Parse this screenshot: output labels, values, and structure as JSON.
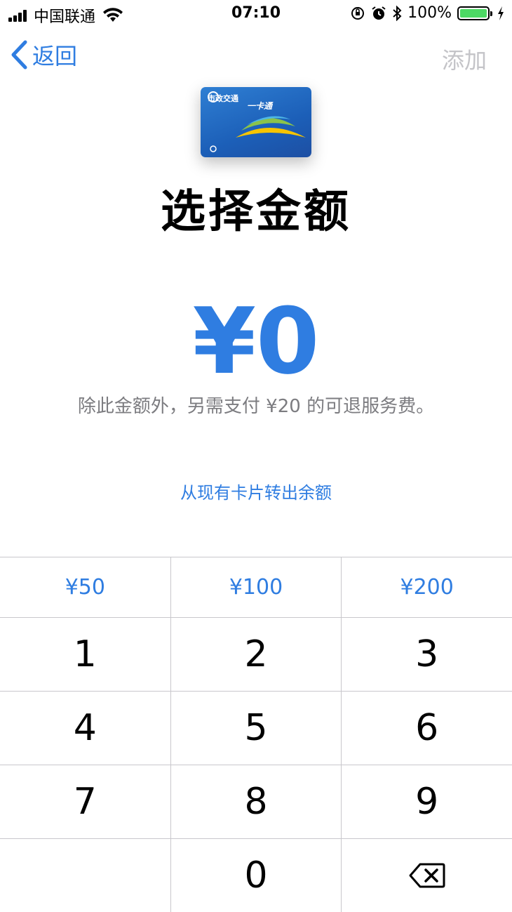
{
  "status_bar": {
    "carrier": "中国联通",
    "time": "07:10",
    "battery": "100%"
  },
  "nav": {
    "back_label": "返回",
    "add_label": "添加"
  },
  "card": {
    "brand_left": "市政交通",
    "brand_right": "一卡通"
  },
  "main": {
    "title": "选择金额",
    "amount": "¥0",
    "note": "除此金额外，另需支付 ¥20 的可退服务费。",
    "transfer_link": "从现有卡片转出余额"
  },
  "keypad": {
    "quick": [
      "¥50",
      "¥100",
      "¥200"
    ],
    "digits": [
      "1",
      "2",
      "3",
      "4",
      "5",
      "6",
      "7",
      "8",
      "9",
      "0"
    ]
  },
  "colors": {
    "accent": "#2f7de1",
    "disabled": "#c4c4c8",
    "secondary_text": "#7c7c80",
    "battery": "#4cd964"
  }
}
